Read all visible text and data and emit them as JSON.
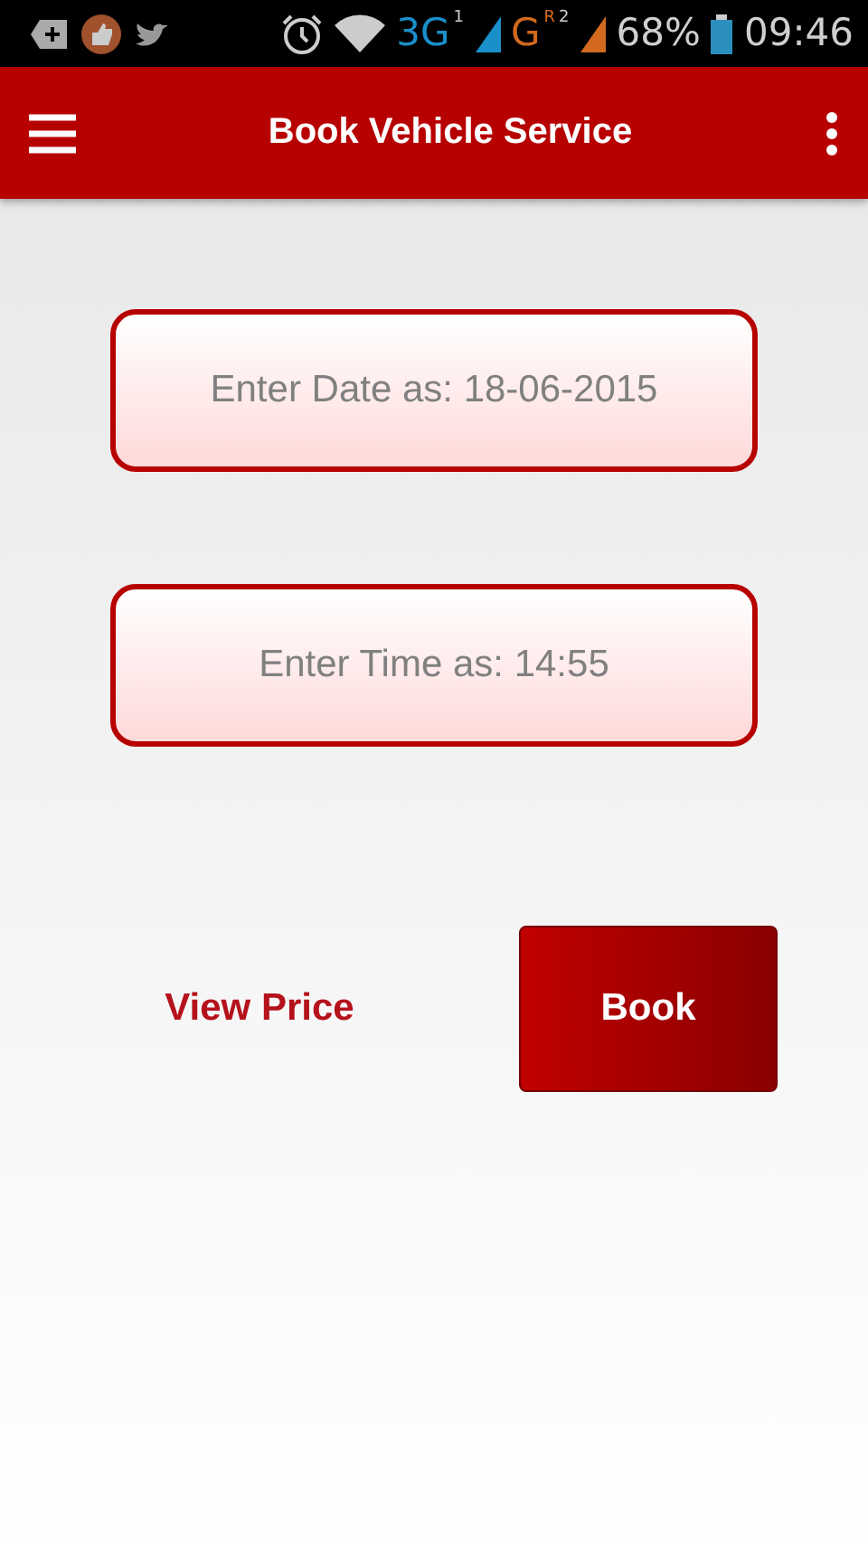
{
  "status_bar": {
    "network_1": "3G",
    "sim_1": "1",
    "network_2": "G",
    "roaming": "R",
    "sim_2": "2",
    "battery": "68%",
    "time": "09:46"
  },
  "app_bar": {
    "title": "Book Vehicle Service"
  },
  "fields": [
    {
      "placeholder": "Enter Date as: 18-06-2015"
    },
    {
      "placeholder": "Enter Time as: 14:55"
    }
  ],
  "actions": {
    "link": "View Price",
    "button": "Book"
  }
}
